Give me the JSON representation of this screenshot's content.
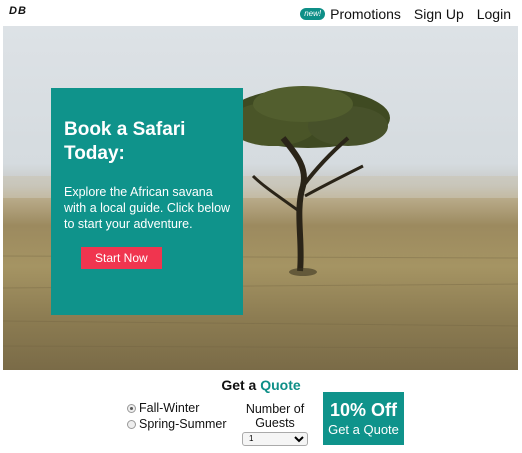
{
  "header": {
    "logo": "DB",
    "badge": "new!",
    "nav": [
      "Promotions",
      "Sign Up",
      "Login"
    ]
  },
  "hero": {
    "title": "Book a Safari Today:",
    "body": "Explore the African savana with a local guide. Click below to start your adventure.",
    "button": "Start Now"
  },
  "quote": {
    "title_prefix": "Get a",
    "title_accent": "Quote",
    "seasons": [
      {
        "label": "Fall-Winter",
        "checked": true
      },
      {
        "label": "Spring-Summer",
        "checked": false
      }
    ],
    "guests_label": "Number of Guests",
    "guests_value": "1",
    "offer_big": "10% Off",
    "offer_small": "Get a Quote"
  },
  "colors": {
    "teal": "#0f938b",
    "red": "#f0354f"
  }
}
